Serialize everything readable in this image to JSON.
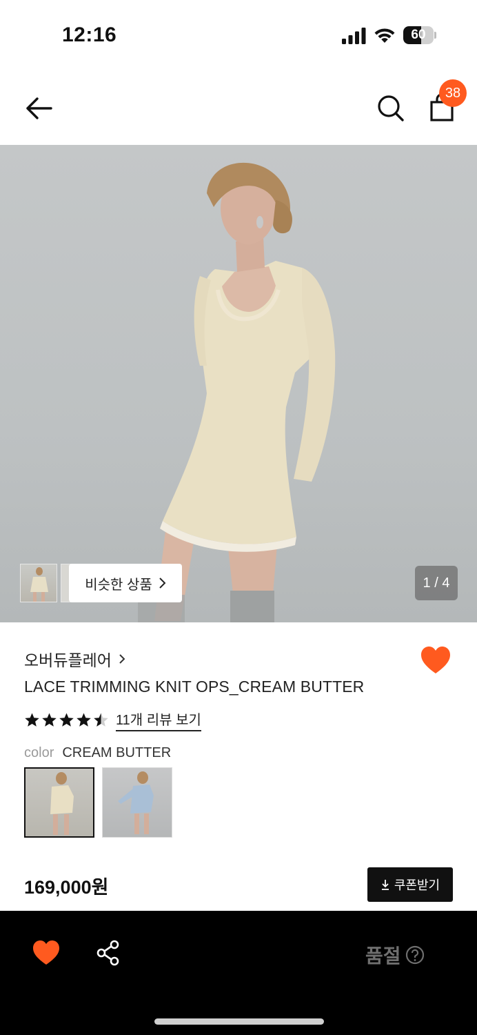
{
  "status_bar": {
    "time": "12:16",
    "battery_percent": 60,
    "battery_label": "60"
  },
  "header": {
    "back_icon": "arrow-left-icon",
    "search_icon": "search-icon",
    "cart_icon": "shopping-bag-icon",
    "cart_count": "38",
    "badge_color": "#ff5a1f"
  },
  "hero": {
    "similar_button_label": "비슷한 상품",
    "page_indicator": "1 / 4"
  },
  "product": {
    "brand": "오버듀플레어",
    "name": "LACE TRIMMING KNIT OPS_CREAM BUTTER",
    "rating": 4.5,
    "review_link": "11개 리뷰 보기",
    "color_label": "color",
    "color_value": "CREAM BUTTER",
    "swatches": [
      "cream-butter",
      "light-blue"
    ],
    "price": "169,000원",
    "coupon_button": "쿠폰받기",
    "accent_color": "#ff5a1f"
  },
  "bottom_bar": {
    "wishlist_icon": "heart-icon",
    "share_icon": "share-icon",
    "status_label": "품절",
    "help_icon": "question-circle-icon"
  }
}
